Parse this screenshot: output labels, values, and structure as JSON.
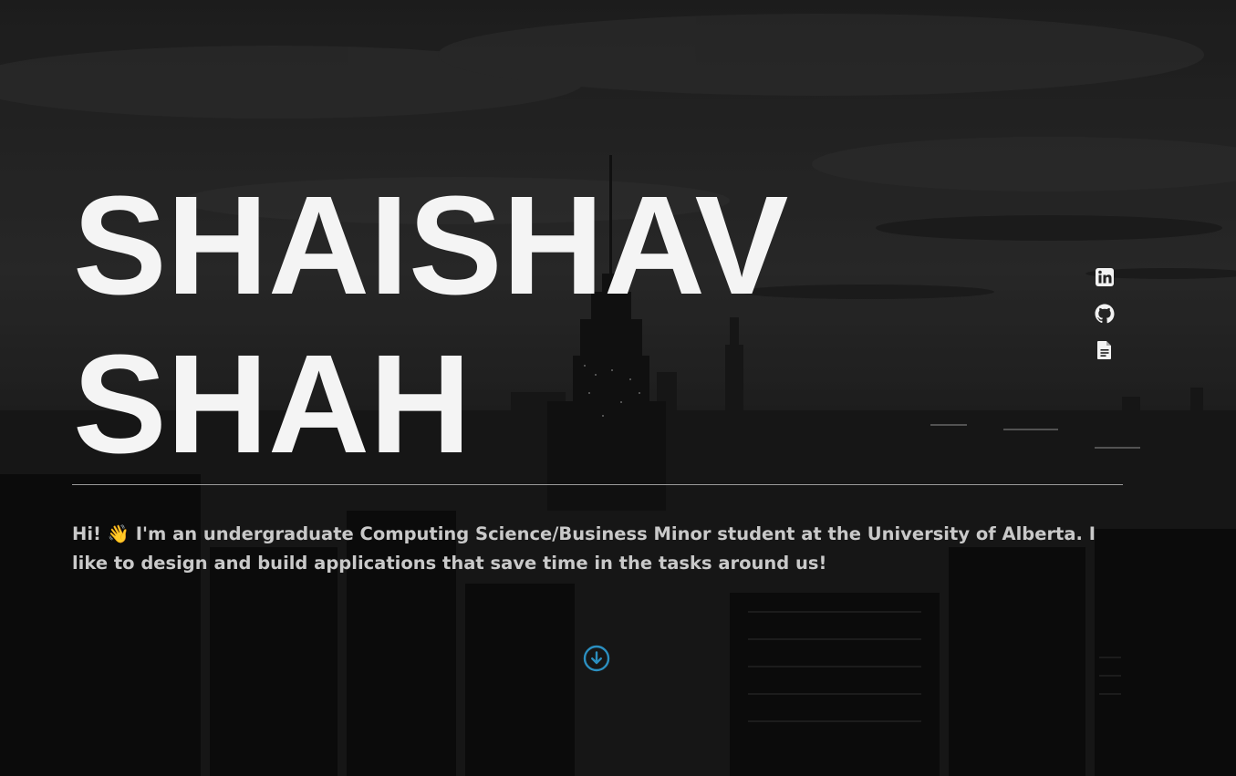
{
  "hero": {
    "name_line1": "SHAISHAV",
    "name_line2": "SHAH",
    "bio": "Hi! 👋 I'm an undergraduate Computing Science/Business Minor student at the University of Alberta. I like to design and build applications that save time in the tasks around us!"
  },
  "socials": [
    {
      "icon": "linkedin-icon"
    },
    {
      "icon": "github-icon"
    },
    {
      "icon": "resume-document-icon"
    }
  ],
  "scroll": {
    "icon": "arrow-down-circle-icon"
  },
  "colors": {
    "text": "#f4f4f4",
    "bio_text": "#c9c9c9",
    "accent": "#2b8fc0",
    "divider": "#9a9a9a"
  }
}
